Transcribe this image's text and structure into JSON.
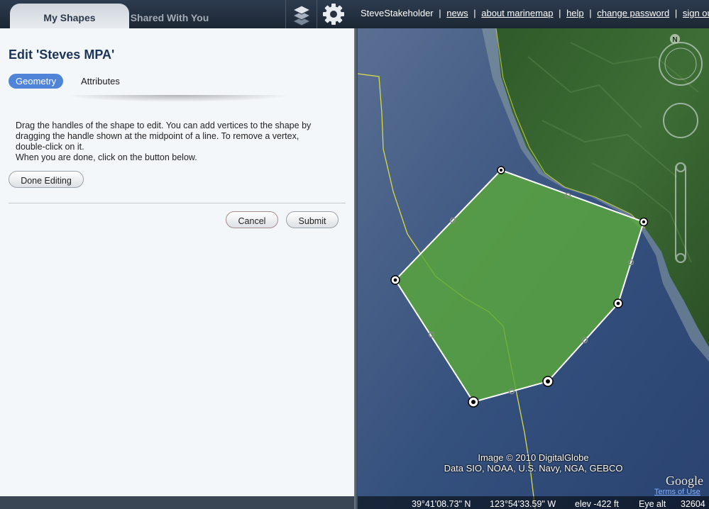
{
  "tabs": {
    "my_shapes": "My Shapes",
    "shared": "Shared With You"
  },
  "icons": {
    "layers": "layers-icon",
    "settings": "gear-icon"
  },
  "user_nav": {
    "username": "SteveStakeholder",
    "separator": "|",
    "links": {
      "news": "news",
      "about": "about marinemap",
      "help": "help",
      "change_password": "change password",
      "sign_out": "sign out"
    }
  },
  "editor": {
    "title": "Edit 'Steves MPA'",
    "subtabs": {
      "geometry": "Geometry",
      "attributes": "Attributes"
    },
    "instructions": {
      "line1": "Drag the handles of the shape to edit. You can add vertices to the shape by",
      "line2": "dragging the handle shown at the midpoint of a line. To remove a vertex,",
      "line3": "double-click on it.",
      "line4": "When you are done, click on the button below."
    },
    "done_label": "Done Editing",
    "cancel_label": "Cancel",
    "submit_label": "Submit"
  },
  "map": {
    "compass_letter": "N",
    "polygon_fill": "#5aa83a",
    "credit_line1": "Image © 2010 DigitalGlobe",
    "credit_line2": "Data SIO, NOAA, U.S. Navy, NGA, GEBCO",
    "logo": "Google",
    "terms": "Terms of Use",
    "status": {
      "lat": "39°41'08.73\" N",
      "lon": "123°54'33.59\" W",
      "elev": "elev  -422 ft",
      "eye": "Eye alt",
      "eye_value": "32604"
    }
  }
}
